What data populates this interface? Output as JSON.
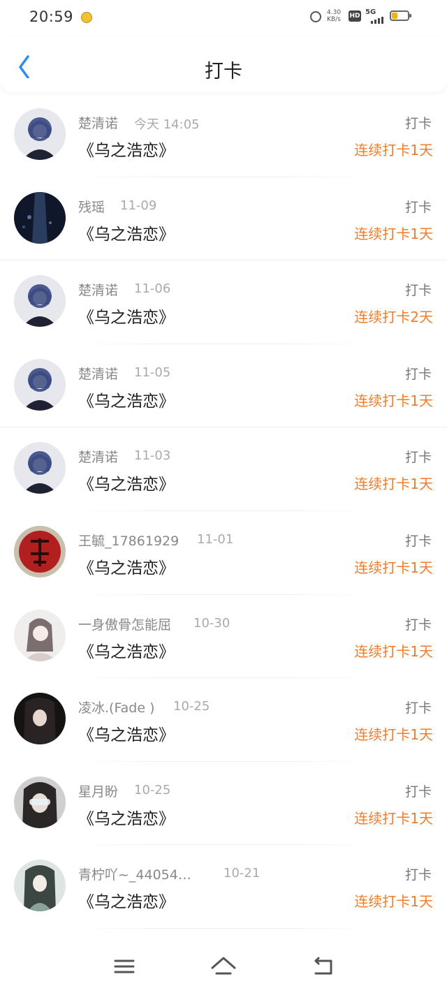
{
  "status": {
    "time": "20:59",
    "speed_value": "4.30",
    "speed_unit": "KB/s",
    "hd": "HD",
    "network": "5G"
  },
  "nav": {
    "title": "打卡",
    "back_icon": "chevron-left-icon"
  },
  "items": [
    {
      "name": "楚清诺",
      "date": "今天 14:05",
      "book": "《乌之浩恋》",
      "action": "打卡",
      "streak": "连续打卡1天"
    },
    {
      "name": "残瑶",
      "date": "11-09",
      "book": "《乌之浩恋》",
      "action": "打卡",
      "streak": "连续打卡1天"
    },
    {
      "name": "楚清诺",
      "date": "11-06",
      "book": "《乌之浩恋》",
      "action": "打卡",
      "streak": "连续打卡2天"
    },
    {
      "name": "楚清诺",
      "date": "11-05",
      "book": "《乌之浩恋》",
      "action": "打卡",
      "streak": "连续打卡1天"
    },
    {
      "name": "楚清诺",
      "date": "11-03",
      "book": "《乌之浩恋》",
      "action": "打卡",
      "streak": "连续打卡1天"
    },
    {
      "name": "王毓_17861929",
      "date": "11-01",
      "book": "《乌之浩恋》",
      "action": "打卡",
      "streak": "连续打卡1天"
    },
    {
      "name": "一身傲骨怎能屈",
      "date": "10-30",
      "book": "《乌之浩恋》",
      "action": "打卡",
      "streak": "连续打卡1天"
    },
    {
      "name": "凌冰.(Fade )",
      "date": "10-25",
      "book": "《乌之浩恋》",
      "action": "打卡",
      "streak": "连续打卡1天"
    },
    {
      "name": "星月盼",
      "date": "10-25",
      "book": "《乌之浩恋》",
      "action": "打卡",
      "streak": "连续打卡1天"
    },
    {
      "name": "青柠吖~_44054…",
      "date": "10-21",
      "book": "《乌之浩恋》",
      "action": "打卡",
      "streak": "连续打卡1天"
    }
  ],
  "colors": {
    "accent_blue": "#2d8cf0",
    "streak_orange": "#f07c2c"
  },
  "bottom_nav": {
    "icons": [
      "menu-icon",
      "home-icon",
      "back-icon"
    ]
  }
}
